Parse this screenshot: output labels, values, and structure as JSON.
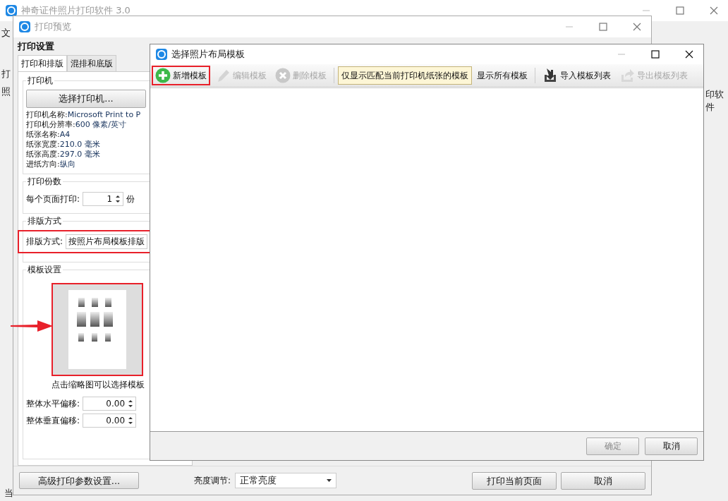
{
  "main_window": {
    "title": "神奇证件照片打印软件 3.0",
    "menu_label": "文",
    "side_labels": [
      "打",
      "照"
    ],
    "right_label": "印软件",
    "status_label": "当"
  },
  "preview_window": {
    "title": "打印预览",
    "panel_title": "打印设置",
    "tabs": [
      {
        "label": "打印和排版",
        "selected": true
      },
      {
        "label": "混排和底版",
        "selected": false
      }
    ],
    "printer": {
      "group_title": "打印机",
      "button": "选择打印机...",
      "info": [
        {
          "label": "打印机名称:",
          "value": "Microsoft Print to P"
        },
        {
          "label": "打印机分辨率:",
          "value": "600 像素/英寸"
        },
        {
          "label": "纸张名称:",
          "value": "A4"
        },
        {
          "label": "纸张宽度:",
          "value": "210.0 毫米"
        },
        {
          "label": "纸张高度:",
          "value": "297.0 毫米"
        },
        {
          "label": "进纸方向:",
          "value": "纵向"
        }
      ]
    },
    "copies": {
      "group_title": "打印份数",
      "label": "每个页面打印:",
      "value": "1",
      "unit": "份"
    },
    "layout": {
      "group_title": "排版方式",
      "label": "排版方式:",
      "value": "按照片布局模板排版",
      "highlighted": true
    },
    "template": {
      "group_title": "模板设置",
      "thumbnail_highlighted": true,
      "pointer_arrow": true,
      "caption": "点击缩略图可以选择模板",
      "offsets": [
        {
          "label": "整体水平偏移:",
          "value": "0.00"
        },
        {
          "label": "整体垂直偏移:",
          "value": "0.00"
        }
      ]
    },
    "advanced_button": "高级打印参数设置...",
    "brightness": {
      "label": "亮度调节:",
      "value": "正常亮度"
    },
    "print_button": "打印当前页面",
    "cancel_button": "取消"
  },
  "dialog": {
    "title": "选择照片布局模板",
    "toolbar": [
      {
        "kind": "add",
        "label": "新增模板",
        "disabled": false,
        "highlighted": true
      },
      {
        "kind": "edit",
        "label": "编辑模板",
        "disabled": true,
        "highlighted": false
      },
      {
        "kind": "delete",
        "label": "删除模板",
        "disabled": true,
        "highlighted": false
      },
      {
        "kind": "separator"
      },
      {
        "kind": "toggle",
        "label": "仅显示匹配当前打印机纸张的模板",
        "selected": true
      },
      {
        "kind": "toggle",
        "label": "显示所有模板",
        "selected": false
      },
      {
        "kind": "separator"
      },
      {
        "kind": "import",
        "label": "导入模板列表",
        "disabled": false,
        "highlighted": false
      },
      {
        "kind": "export",
        "label": "导出模板列表",
        "disabled": true,
        "highlighted": false
      }
    ],
    "ok_button": {
      "label": "确定",
      "disabled": true
    },
    "cancel_button": {
      "label": "取消",
      "disabled": false
    }
  }
}
